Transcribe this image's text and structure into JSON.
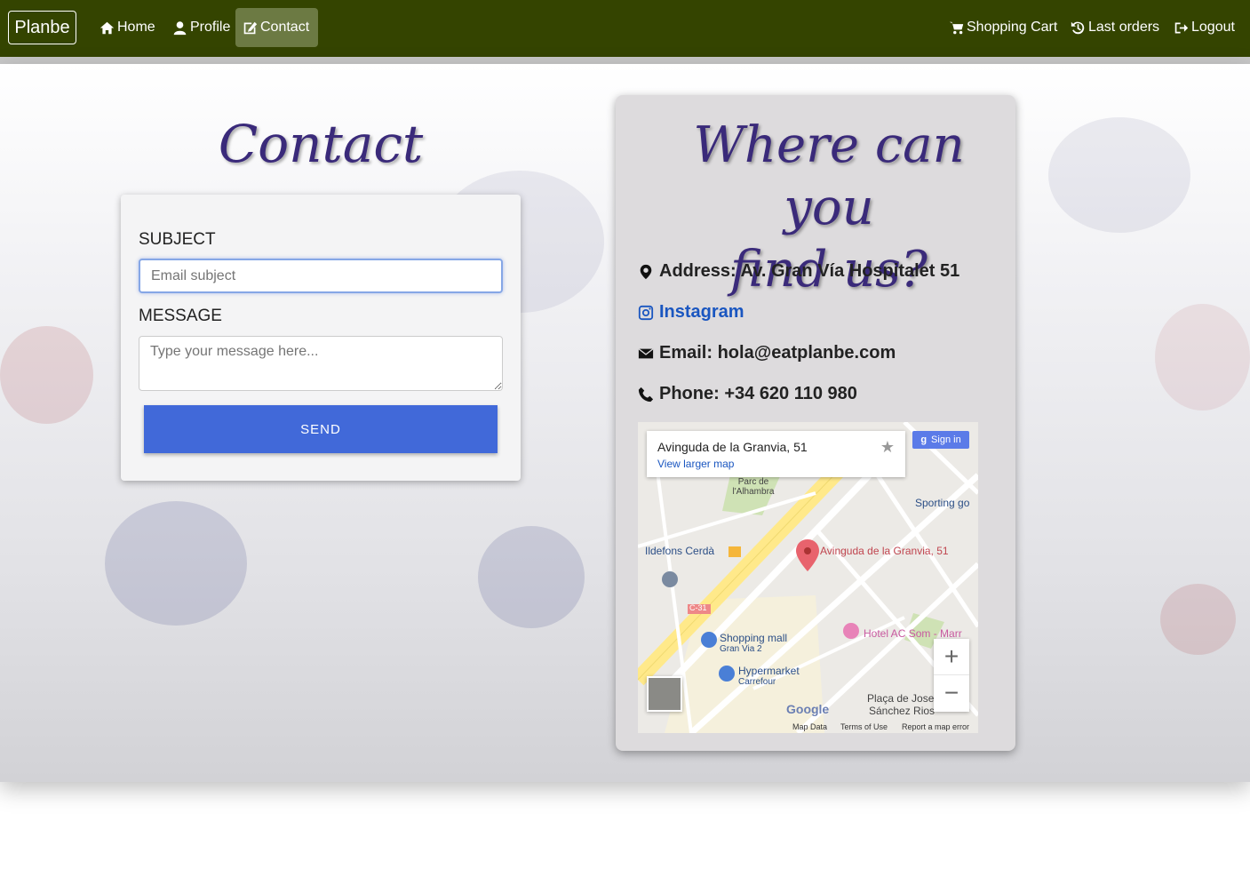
{
  "nav": {
    "brand": "Planbe",
    "home": "Home",
    "profile": "Profile",
    "contact": "Contact",
    "cart": "Shopping Cart",
    "orders": "Last orders",
    "logout": "Logout"
  },
  "contact": {
    "title": "Contact",
    "subject_label": "SUBJECT",
    "subject_placeholder": "Email subject",
    "message_label": "MESSAGE",
    "message_placeholder": "Type your message here...",
    "send_label": "SEND"
  },
  "find_us": {
    "title_line1": "Where can you",
    "title_line2": "find us?",
    "address": "Address: Av. Gran Vía Hospitalet 51",
    "instagram": "Instagram",
    "email": "Email: hola@eatplanbe.com",
    "phone": "Phone: +34 620 110 980"
  },
  "map": {
    "place_name": "Avinguda de la Granvia, 51",
    "view_larger": "View larger map",
    "sign_in": "Sign in",
    "labels": {
      "pin": "Avinguda de la Granvia, 51",
      "ildefons": "Ildefons Cerdà",
      "shopping": "Shopping mall",
      "shopping_sub": "Gran Via 2",
      "hyper": "Hypermarket",
      "hyper_sub": "Carrefour",
      "sporting": "Sporting go",
      "hotel": "Hotel AC Som - Marr",
      "placa": "Plaça de Josep",
      "placa2": "Sánchez Rios",
      "parc": "Parc de l'Alhambra",
      "c31": "C-31",
      "google": "Google"
    },
    "footer_data": "Map Data",
    "footer_terms": "Terms of Use",
    "footer_report": "Report a map error",
    "zoom_in": "+",
    "zoom_out": "−"
  },
  "colors": {
    "navbar": "#344400",
    "active_nav": "#6c7a43",
    "send_button": "#4169d9",
    "title": "#3a2a7a",
    "instagram": "#1a56c0"
  }
}
